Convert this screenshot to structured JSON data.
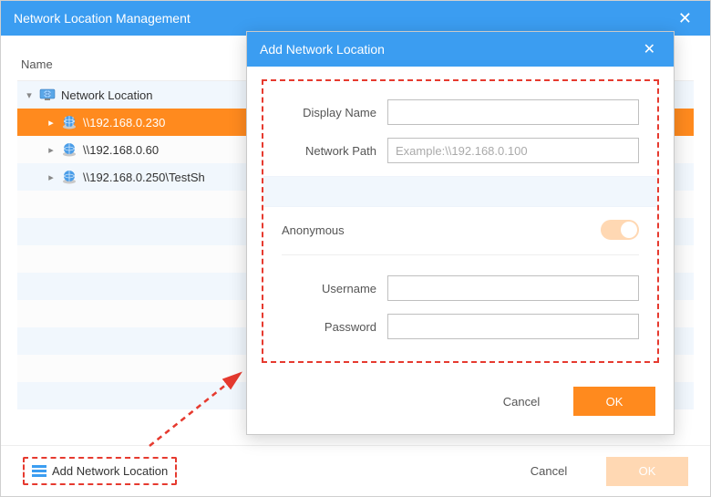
{
  "main": {
    "title": "Network Location Management",
    "nameHeader": "Name",
    "rootLabel": "Network Location",
    "items": [
      {
        "label": "\\\\192.168.0.230",
        "selected": true
      },
      {
        "label": "\\\\192.168.0.60",
        "selected": false
      },
      {
        "label": "\\\\192.168.0.250\\TestSh",
        "selected": false
      }
    ],
    "addLink": "Add Network Location",
    "cancel": "Cancel",
    "ok": "OK"
  },
  "modal": {
    "title": "Add Network Location",
    "displayNameLabel": "Display Name",
    "displayNameValue": "",
    "networkPathLabel": "Network Path",
    "networkPathPlaceholder": "Example:\\\\192.168.0.100",
    "networkPathValue": "",
    "anonymousLabel": "Anonymous",
    "usernameLabel": "Username",
    "usernameValue": "",
    "passwordLabel": "Password",
    "passwordValue": "",
    "cancel": "Cancel",
    "ok": "OK"
  }
}
